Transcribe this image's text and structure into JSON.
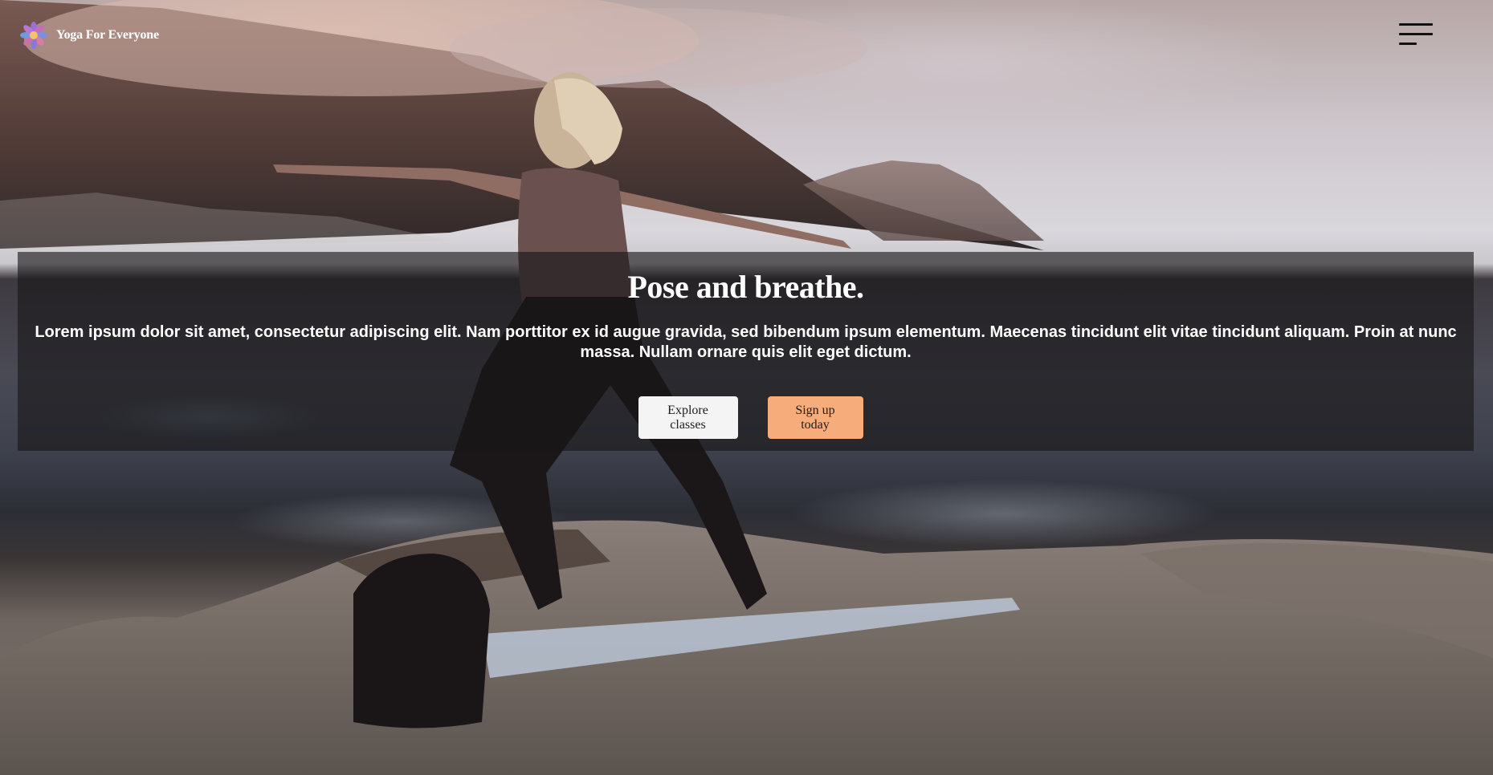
{
  "header": {
    "brand_name": "Yoga For Everyone",
    "logo_icon": "lotus-flower-icon",
    "menu_icon": "hamburger-menu-icon"
  },
  "hero": {
    "title": "Pose and breathe.",
    "body": "Lorem ipsum dolor sit amet, consectetur adipiscing elit. Nam porttitor ex id augue gravida, sed bibendum ipsum elementum. Maecenas tincidunt elit vitae tincidunt aliquam. Proin at nunc massa. Nullam ornare quis elit eget dictum.",
    "primary_button": "Explore classes",
    "secondary_button": "Sign up today"
  },
  "colors": {
    "overlay": "#19161880",
    "explore_button": "#f4f4f4",
    "signup_button": "#f6ad7b",
    "text": "#ffffff"
  }
}
